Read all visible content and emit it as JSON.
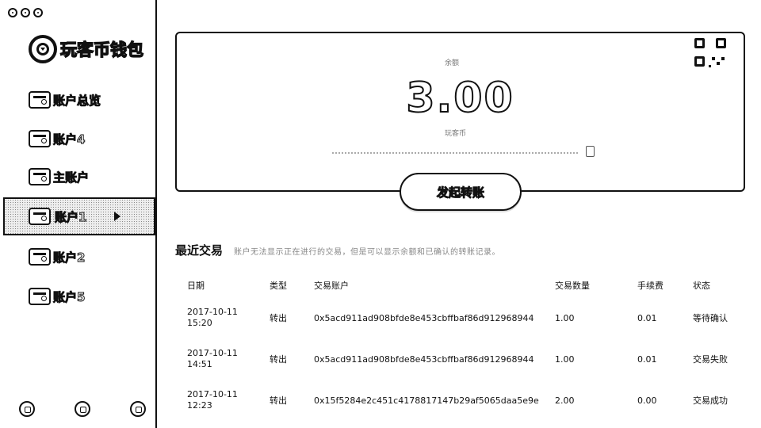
{
  "app": {
    "logo_text": "玩客币钱包"
  },
  "sidebar": {
    "items": [
      {
        "label": "账户总览",
        "active": false
      },
      {
        "label": "账户4",
        "active": false
      },
      {
        "label": "主账户",
        "active": false
      },
      {
        "label": "账户1",
        "active": true
      },
      {
        "label": "账户2",
        "active": false
      },
      {
        "label": "账户5",
        "active": false
      }
    ]
  },
  "balance": {
    "caption": "余额",
    "amount": "3.00",
    "unit": "玩客币"
  },
  "actions": {
    "transfer_label": "发起转账"
  },
  "recent": {
    "title": "最近交易",
    "hint": "账户无法显示正在进行的交易，但是可以显示余额和已确认的转账记录。",
    "columns": [
      "日期",
      "类型",
      "交易账户",
      "交易数量",
      "手续费",
      "状态"
    ],
    "rows": [
      {
        "date": "2017-10-11",
        "time": "15:20",
        "type": "转出",
        "account": "0x5acd911ad908bfde8e453cbffbaf86d912968944",
        "amount": "1.00",
        "fee": "0.01",
        "status": "等待确认"
      },
      {
        "date": "2017-10-11",
        "time": "14:51",
        "type": "转出",
        "account": "0x5acd911ad908bfde8e453cbffbaf86d912968944",
        "amount": "1.00",
        "fee": "0.01",
        "status": "交易失败"
      },
      {
        "date": "2017-10-11",
        "time": "12:23",
        "type": "转出",
        "account": "0x15f5284e2c451c4178817147b29af5065daa5e9e",
        "amount": "2.00",
        "fee": "0.00",
        "status": "交易成功"
      }
    ]
  },
  "colors": {
    "ink": "#111111",
    "background": "#ffffff",
    "muted": "#888888"
  }
}
